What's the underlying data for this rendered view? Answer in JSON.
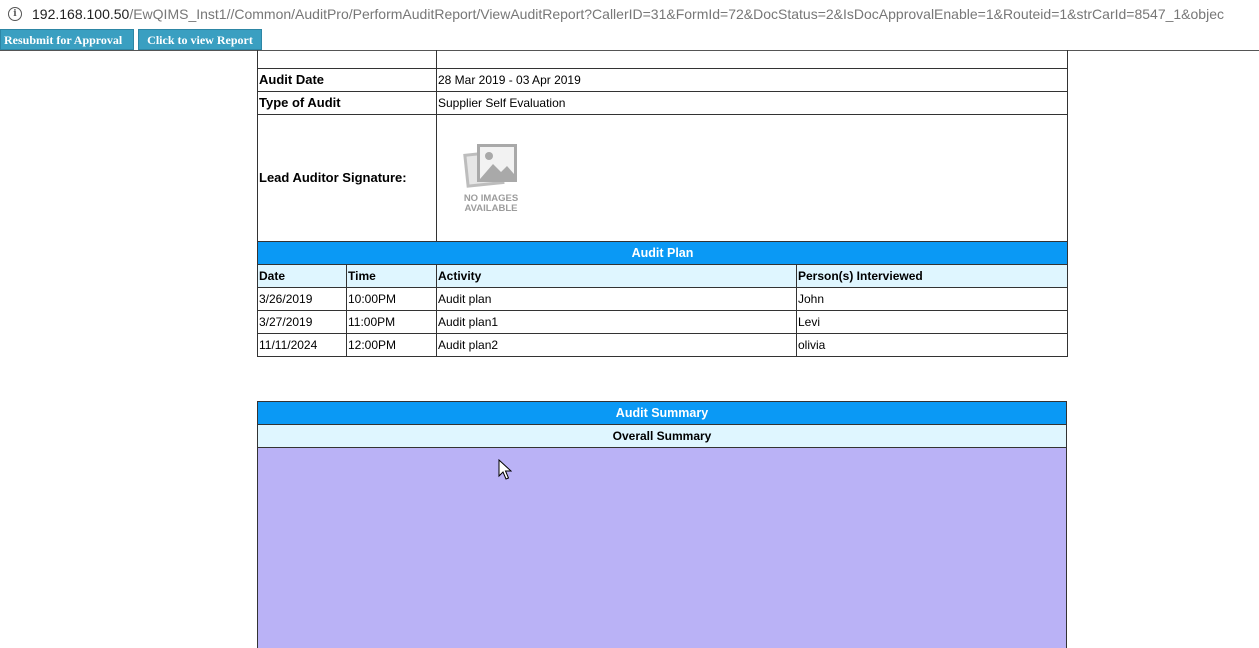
{
  "browser": {
    "url_host": "192.168.100.50",
    "url_path": "/EwQIMS_Inst1//Common/AuditPro/PerformAuditReport/ViewAuditReport?CallerID=31&FormId=72&DocStatus=2&IsDocApprovalEnable=1&Routeid=1&strCarId=8547_1&objec"
  },
  "toolbar": {
    "resubmit_label": "Resubmit for Approval",
    "view_label": "Click to view Report"
  },
  "audit_info": {
    "audit_date_label": "Audit Date",
    "audit_date_value": "28 Mar 2019 - 03 Apr 2019",
    "type_label": "Type of Audit",
    "type_value": "Supplier Self Evaluation",
    "signature_label": "Lead Auditor Signature:",
    "no_image_line1": "NO IMAGES",
    "no_image_line2": "AVAILABLE"
  },
  "audit_plan": {
    "title": "Audit Plan",
    "headers": {
      "date": "Date",
      "time": "Time",
      "activity": "Activity",
      "persons": "Person(s) Interviewed"
    },
    "rows": [
      {
        "date": "3/26/2019",
        "time": "10:00PM",
        "activity": "Audit plan",
        "persons": "John"
      },
      {
        "date": "3/27/2019",
        "time": "11:00PM",
        "activity": "Audit plan1",
        "persons": "Levi"
      },
      {
        "date": "11/11/2024",
        "time": "12:00PM",
        "activity": "Audit plan2",
        "persons": "olivia"
      }
    ]
  },
  "audit_summary": {
    "title": "Audit Summary",
    "subtitle": "Overall Summary"
  },
  "colors": {
    "band_blue": "#0a99f5",
    "band_light": "#dff6ff",
    "summary_fill": "#bab2f6",
    "button": "#3a9fc1"
  }
}
